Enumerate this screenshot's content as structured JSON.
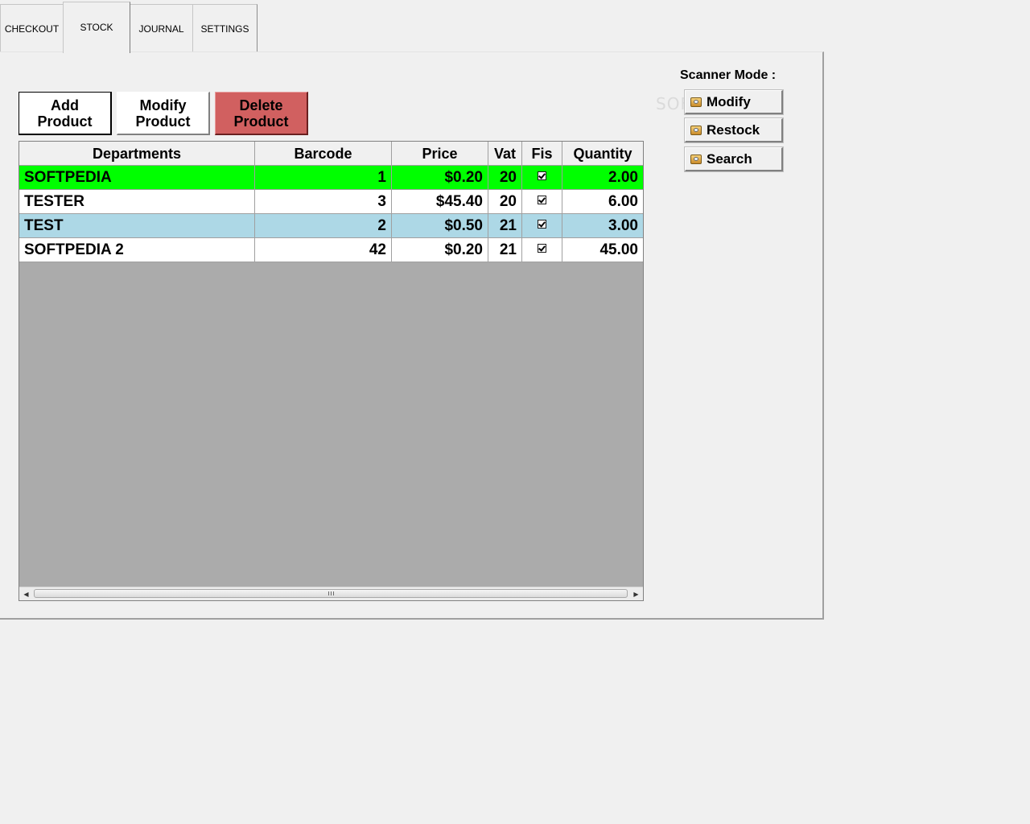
{
  "tabs": [
    {
      "label": "CHECKOUT",
      "active": false
    },
    {
      "label": "STOCK",
      "active": true
    },
    {
      "label": "JOURNAL",
      "active": false
    },
    {
      "label": "SETTINGS",
      "active": false
    }
  ],
  "actions": {
    "add": "Add\nProduct",
    "modify": "Modify\nProduct",
    "delete": "Delete\nProduct"
  },
  "colors": {
    "delete_button": "#d16060",
    "row_highlight_selected": "#00ff00",
    "row_alt": "#add8e6",
    "grid_empty": "#ababab"
  },
  "grid": {
    "columns": [
      "Departments",
      "Barcode",
      "Price",
      "Vat",
      "Fis",
      "Quantity"
    ],
    "rows": [
      {
        "department": "SOFTPEDIA",
        "barcode": "1",
        "price": "$0.20",
        "vat": "20",
        "fis": true,
        "quantity": "2.00",
        "bg": "#00ff00"
      },
      {
        "department": "TESTER",
        "barcode": "3",
        "price": "$45.40",
        "vat": "20",
        "fis": true,
        "quantity": "6.00",
        "bg": "#ffffff"
      },
      {
        "department": "TEST",
        "barcode": "2",
        "price": "$0.50",
        "vat": "21",
        "fis": true,
        "quantity": "3.00",
        "bg": "#add8e6"
      },
      {
        "department": "SOFTPEDIA 2",
        "barcode": "42",
        "price": "$0.20",
        "vat": "21",
        "fis": true,
        "quantity": "45.00",
        "bg": "#ffffff"
      }
    ]
  },
  "scanner": {
    "label": "Scanner Mode :",
    "modify": "Modify",
    "restock": "Restock",
    "search": "Search"
  },
  "watermark": "SOFTPEDIA"
}
